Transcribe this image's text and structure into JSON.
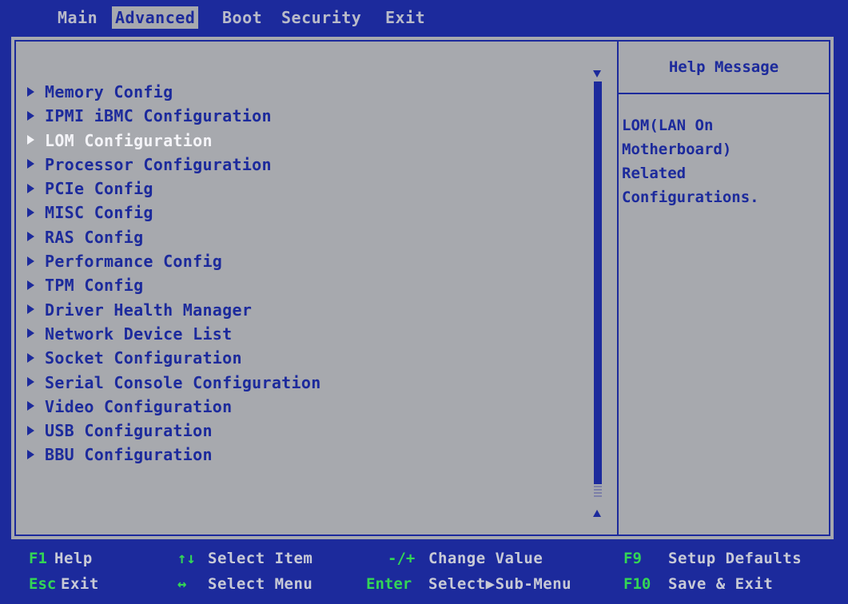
{
  "menu_tabs": [
    {
      "label": "Main",
      "active": false
    },
    {
      "label": "Advanced",
      "active": true
    },
    {
      "label": "Boot",
      "active": false
    },
    {
      "label": "Security",
      "active": false
    },
    {
      "label": "Exit",
      "active": false
    }
  ],
  "menu_items": [
    {
      "label": "Memory Config"
    },
    {
      "label": "IPMI iBMC Configuration"
    },
    {
      "label": "LOM Configuration",
      "selected": true
    },
    {
      "label": "Processor Configuration"
    },
    {
      "label": "PCIe Config"
    },
    {
      "label": "MISC Config"
    },
    {
      "label": "RAS Config"
    },
    {
      "label": "Performance Config"
    },
    {
      "label": "TPM Config"
    },
    {
      "label": "Driver Health Manager"
    },
    {
      "label": "Network Device List"
    },
    {
      "label": "Socket Configuration"
    },
    {
      "label": "Serial Console Configuration"
    },
    {
      "label": "Video Configuration"
    },
    {
      "label": "USB Configuration"
    },
    {
      "label": "BBU Configuration"
    }
  ],
  "help": {
    "title": "Help Message",
    "text": "LOM(LAN On\nMotherboard)\nRelated\nConfigurations."
  },
  "legend": {
    "f1_key": "F1",
    "f1_desc": "Help",
    "updown_key": "↑↓",
    "updown_desc": "Select Item",
    "minusplus_key": "-/+",
    "minusplus_desc": "Change Value",
    "f9_key": "F9",
    "f9_desc": "Setup Defaults",
    "esc_key": "Esc",
    "esc_desc": "Exit",
    "leftright_key": "↔",
    "leftright_desc": "Select Menu",
    "enter_key": "Enter",
    "enter_desc": "Select▶Sub-Menu",
    "f10_key": "F10",
    "f10_desc": "Save & Exit"
  },
  "colors": {
    "background_blue": "#1c2a9c",
    "panel_gray": "#a7a9ae",
    "key_green": "#33d655",
    "selected_white": "#f4f4f8"
  },
  "icons": {
    "submenu_arrow": "right-triangle",
    "scroll_down": "down-triangle",
    "scroll_up": "up-triangle"
  }
}
